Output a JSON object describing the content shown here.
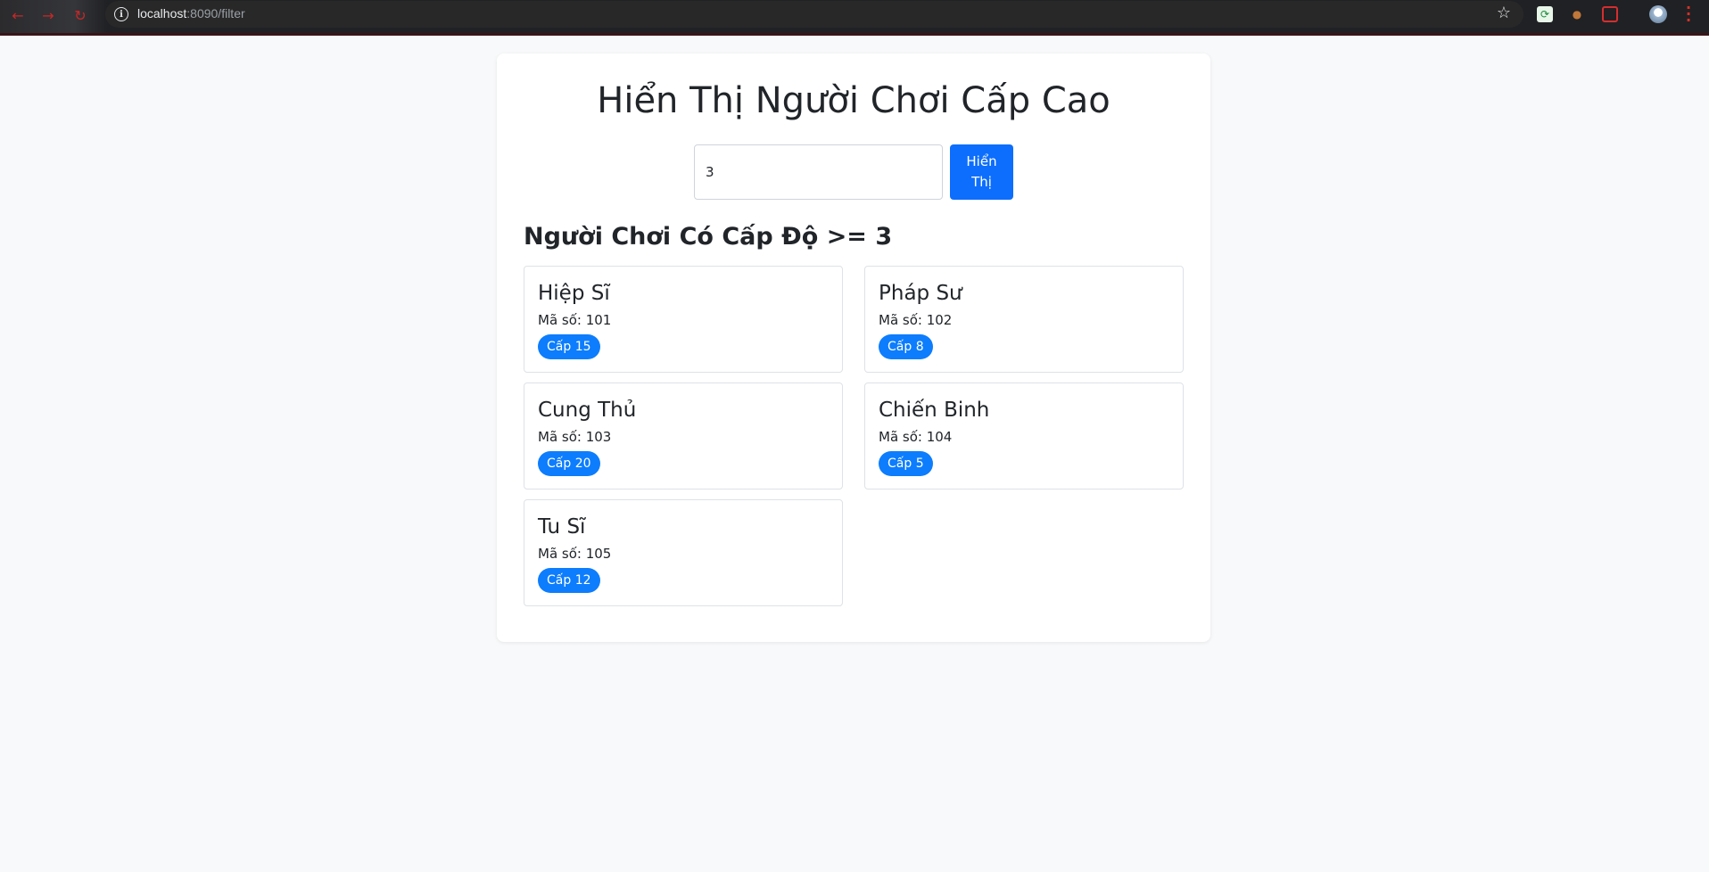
{
  "browser": {
    "url_host": "localhost",
    "url_path": ":8090/filter"
  },
  "page": {
    "title": "Hiển Thị Người Chơi Cấp Cao",
    "filter": {
      "value": "3",
      "button_label": "Hiển Thị"
    },
    "subtitle": "Người Chơi Có Cấp Độ >= 3",
    "players": [
      {
        "name": "Hiệp Sĩ",
        "id_text": "Mã số: 101",
        "level_text": "Cấp 15"
      },
      {
        "name": "Pháp Sư",
        "id_text": "Mã số: 102",
        "level_text": "Cấp 8"
      },
      {
        "name": "Cung Thủ",
        "id_text": "Mã số: 103",
        "level_text": "Cấp 20"
      },
      {
        "name": "Chiến Binh",
        "id_text": "Mã số: 104",
        "level_text": "Cấp 5"
      },
      {
        "name": "Tu Sĩ",
        "id_text": "Mã số: 105",
        "level_text": "Cấp 12"
      }
    ]
  },
  "colors": {
    "primary": "#0d6efd",
    "badge": "#0d7dfd",
    "background": "#f8f9fa"
  }
}
